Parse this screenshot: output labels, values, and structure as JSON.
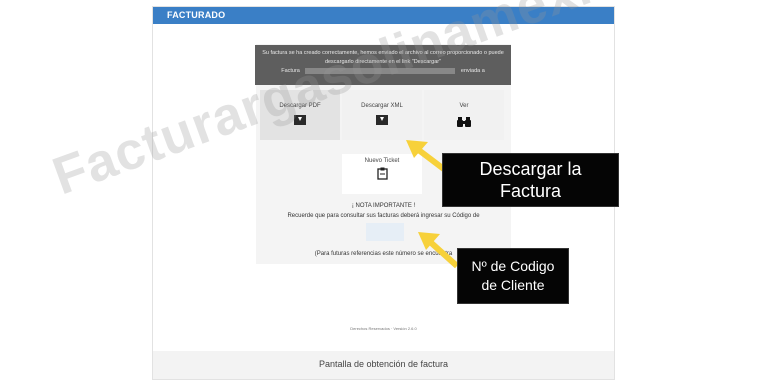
{
  "header": {
    "title": "FACTURADO"
  },
  "notice": {
    "line1": "Su factura se ha creado correctamente, hemos enviado el archivo al correo proporcionado o puede",
    "line2": "descargarlo directamente en el link \"Descargar\"",
    "line3_left": "Factura",
    "line3_right": "enviada a"
  },
  "options": {
    "pdf": "Descargar PDF",
    "xml": "Descargar XML",
    "ver": "Ver",
    "nuevo": "Nuevo Ticket"
  },
  "nota": {
    "title": "¡ NOTA IMPORTANTE !",
    "text": "Recuerde que para consultar sus facturas deberá ingresar su Código de"
  },
  "futuras": "(Para futuras referencias este número se encuentra",
  "footer_note": "Derechos Reservados · Versión 2.6.0",
  "caption": "Pantalla de obtención de factura",
  "callouts": {
    "descargar": [
      "Descargar la",
      "Factura"
    ],
    "codigo": [
      "Nº de Codigo",
      "de Cliente"
    ]
  },
  "watermark": "Facturargasolinamexico.com",
  "colors": {
    "header": "#3a7fc6",
    "arrow": "#f7d13a",
    "callout_bg": "#050505"
  }
}
